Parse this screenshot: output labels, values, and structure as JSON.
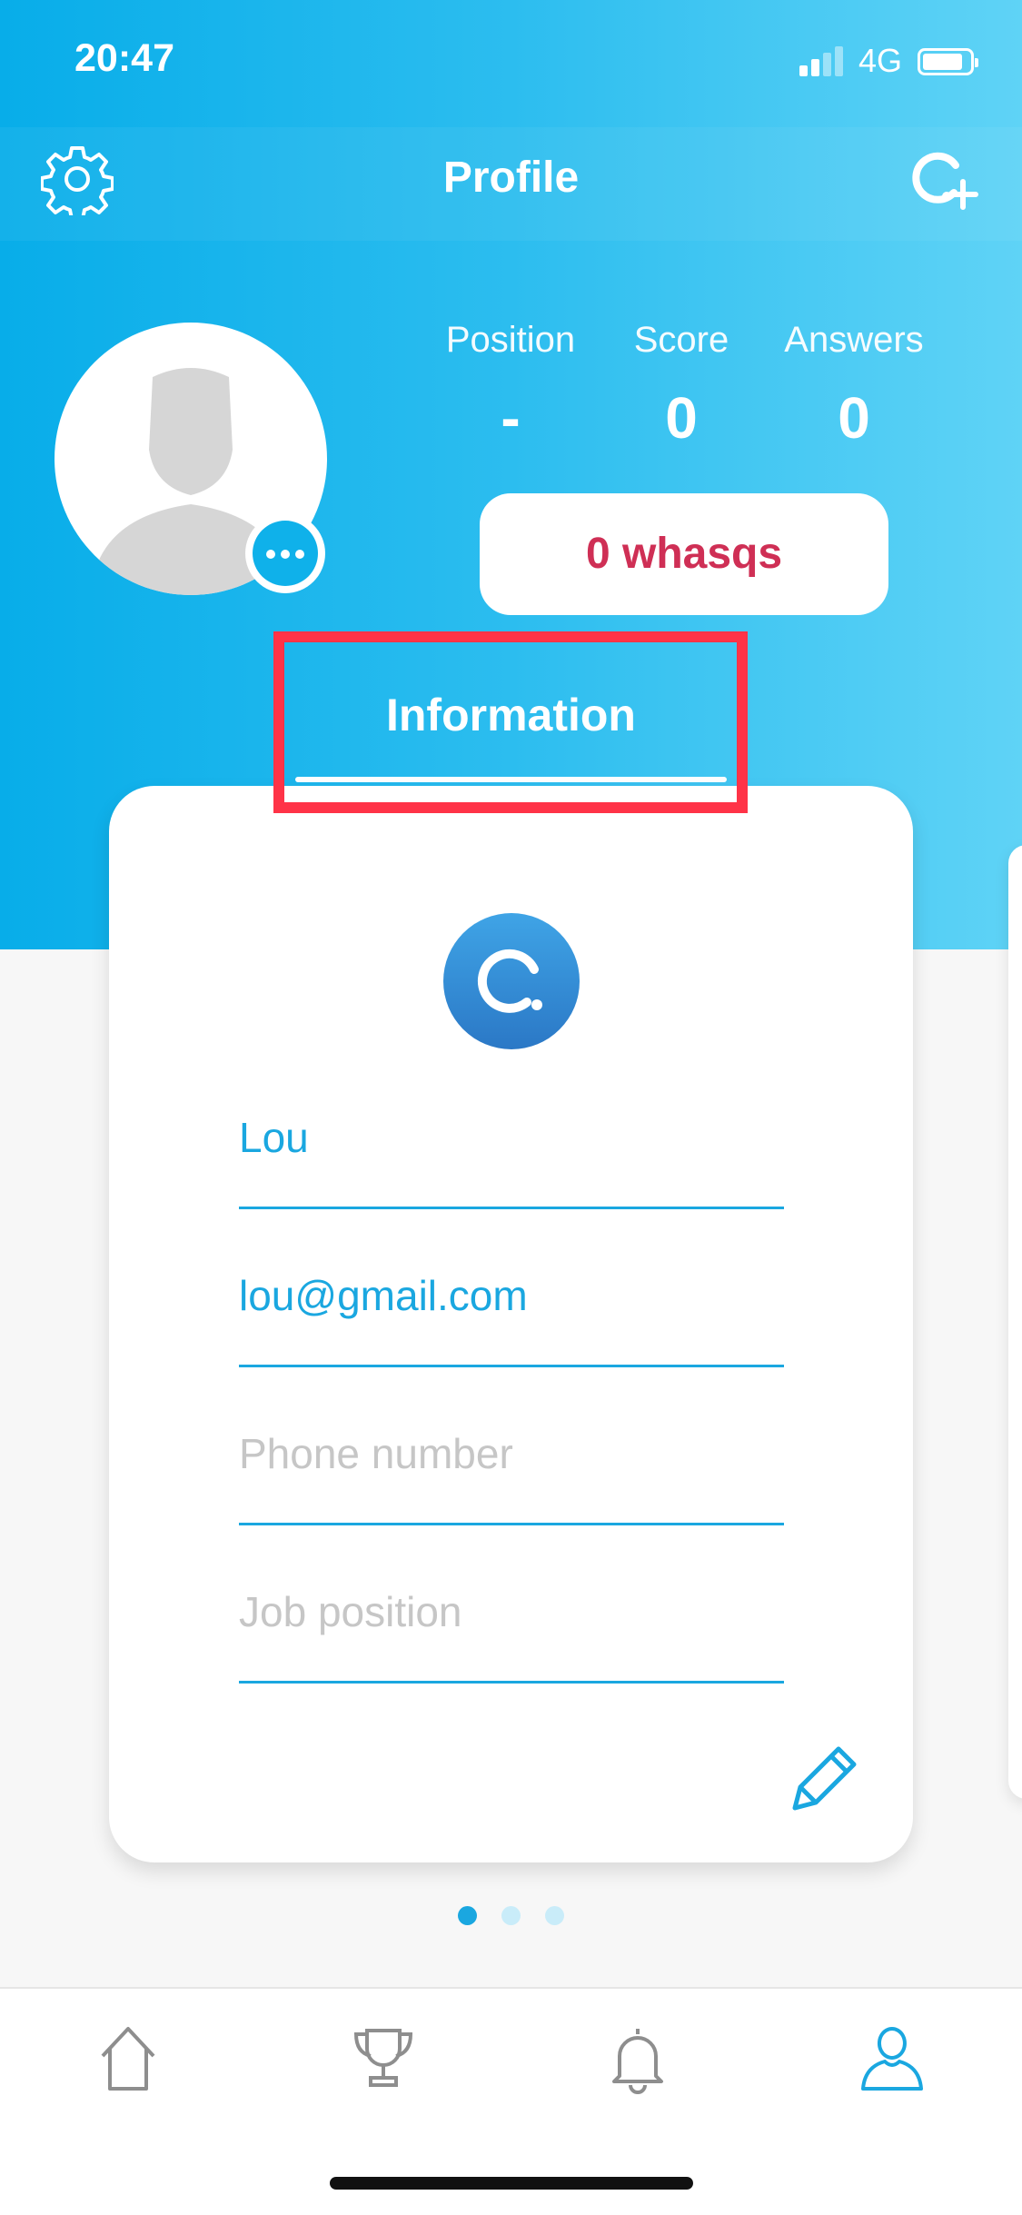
{
  "status_bar": {
    "time": "20:47",
    "network": "4G"
  },
  "header": {
    "title": "Profile",
    "settings_icon": "gear-icon",
    "action_icon": "add-question-icon"
  },
  "profile": {
    "avatar_icon": "default-avatar",
    "more_icon": "more-dots-icon",
    "stats": [
      {
        "label": "Position",
        "value": "-"
      },
      {
        "label": "Score",
        "value": "0"
      },
      {
        "label": "Answers",
        "value": "0"
      }
    ],
    "whasqs_label": "0 whasqs"
  },
  "tabs": {
    "active": "Information"
  },
  "card": {
    "logo_icon": "whasq-logo-icon",
    "fields": [
      {
        "value": "Lou",
        "placeholder": ""
      },
      {
        "value": "lou@gmail.com",
        "placeholder": ""
      },
      {
        "value": "",
        "placeholder": "Phone number"
      },
      {
        "value": "",
        "placeholder": "Job position"
      }
    ],
    "edit_icon": "pencil-icon"
  },
  "pager": {
    "count": 3,
    "active_index": 0
  },
  "tab_bar": {
    "items": [
      {
        "icon": "home-icon",
        "active": false
      },
      {
        "icon": "trophy-icon",
        "active": false
      },
      {
        "icon": "bell-icon",
        "active": false
      },
      {
        "icon": "user-icon",
        "active": true
      }
    ]
  },
  "colors": {
    "primary": "#1aa7e0",
    "hero_gradient_start": "#08ade9",
    "hero_gradient_end": "#5fd3f6",
    "whasqs_text": "#cf2f55",
    "highlight": "#ff3347",
    "placeholder": "#c6c6c6",
    "inactive_icon": "#8e8e8e"
  }
}
